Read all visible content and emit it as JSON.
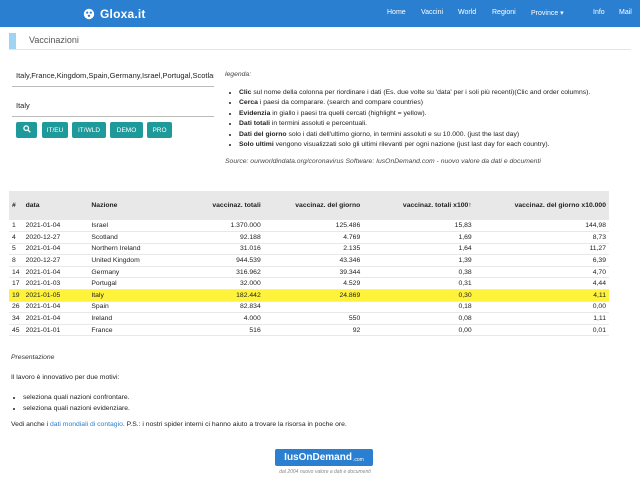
{
  "nav": {
    "brand": "Gloxa.it",
    "items": [
      "Home",
      "Vaccini",
      "World",
      "Regioni",
      "Province ▾",
      "Info",
      "Mail"
    ]
  },
  "page": {
    "heading": "Vaccinazioni"
  },
  "search": {
    "countries_value": "Italy,France,Kingdom,Spain,Germany,Israel,Portugal,Scotland,Wales,Ireland",
    "highlight_value": "Italy"
  },
  "buttons": {
    "search_icon": "search-icon",
    "labels": [
      "IT/EU",
      "IT/WLD",
      "DEMO",
      "PRO"
    ]
  },
  "legend": {
    "title": "legenda:",
    "items": [
      {
        "bold": "Clic",
        "text": " sul nome della colonna per riordinare i dati (Es. due volte su 'data' per i soli più recenti)(Clic and order columns)."
      },
      {
        "bold": "Cerca",
        "text": " i paesi da comparare. (search and compare countries)"
      },
      {
        "bold": "Evidenzia",
        "text": " in giallo i paesi tra quelli cercati (highlight = yellow)."
      },
      {
        "bold": "Dati totali",
        "text": " in termini assoluti e percentuali."
      },
      {
        "bold": "Dati del giorno",
        "text": " solo i dati dell'ultimo giorno, in termini assoluti e su 10.000. (just the last day)"
      },
      {
        "bold": "Solo ultimi",
        "text": " vengono visualizzati solo gli ultimi rilevanti per ogni nazione (just last day for each country)."
      }
    ],
    "source": "Source: ourworldindata.org/coronavirus Software: IusOnDemand.com - nuovo valore da dati e documenti"
  },
  "table": {
    "headers": [
      "#",
      "data",
      "Nazione",
      "vaccinaz. totali",
      "vaccinaz. del giorno",
      "vaccinaz. totali x100↑",
      "vaccinaz. del giorno x10.000"
    ],
    "rows": [
      [
        "1",
        "2021-01-04",
        "Israel",
        "1.370.000",
        "125.486",
        "15,83",
        "144,98"
      ],
      [
        "4",
        "2020-12-27",
        "Scotland",
        "92.188",
        "4.769",
        "1,69",
        "8,73"
      ],
      [
        "5",
        "2021-01-04",
        "Northern Ireland",
        "31.016",
        "2.135",
        "1,64",
        "11,27"
      ],
      [
        "8",
        "2020-12-27",
        "United Kingdom",
        "944.539",
        "43.346",
        "1,39",
        "6,39"
      ],
      [
        "14",
        "2021-01-04",
        "Germany",
        "316.962",
        "39.344",
        "0,38",
        "4,70"
      ],
      [
        "17",
        "2021-01-03",
        "Portugal",
        "32.000",
        "4.529",
        "0,31",
        "4,44"
      ],
      [
        "19",
        "2021-01-05",
        "Italy",
        "182.442",
        "24.869",
        "0,30",
        "4,11"
      ],
      [
        "26",
        "2021-01-04",
        "Spain",
        "82.834",
        "",
        "0,18",
        "0,00"
      ],
      [
        "34",
        "2021-01-04",
        "Ireland",
        "4.000",
        "550",
        "0,08",
        "1,11"
      ],
      [
        "45",
        "2021-01-01",
        "France",
        "516",
        "92",
        "0,00",
        "0,01"
      ]
    ],
    "highlight_row_index": 6,
    "highlight_color": "#fff23a"
  },
  "content": {
    "caption": "Presentazione",
    "intro": "Il lavoro è innovativo per due motivi:",
    "bullets": [
      "seleziona quali nazioni confrontare.",
      "seleziona quali nazioni evidenziare."
    ],
    "see_also_prefix": "Vedi anche i ",
    "see_also_link": "dati mondiali di contagio",
    "see_also_suffix": ". P.S.: i nostri spider interni ci hanno aiuto a trovare la risorsa in poche ore."
  },
  "footer": {
    "logo_text": "IusOnDemand",
    "logo_tld": ".com",
    "tagline": "dal 2004 nuovo valore a dati e documenti"
  },
  "colors": {
    "navbar": "#2a7fd0",
    "button": "#1e9a9b",
    "heading_accent": "#9fd3f2"
  }
}
